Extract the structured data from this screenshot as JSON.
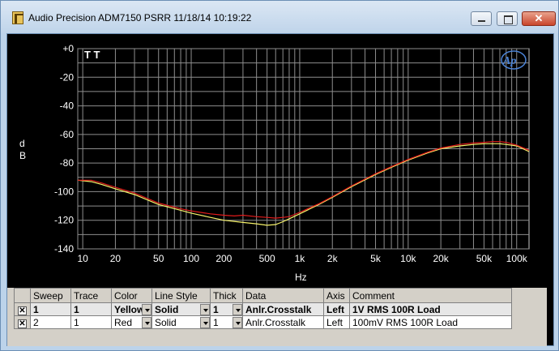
{
  "window": {
    "title": "Audio Precision  ADM7150 PSRR  11/18/14 10:19:22",
    "icon": "app-logo-icon"
  },
  "colors": {
    "yellow": "#f6f26a",
    "red": "#e21b1b",
    "grid": "#8e8e8e",
    "text": "#ffffff"
  },
  "chart_data": {
    "type": "line",
    "xscale": "log",
    "xlabel": "Hz",
    "ylabel": "d\nB",
    "xlim": [
      9,
      130000
    ],
    "ylim": [
      -140,
      0
    ],
    "x_ticks": [
      {
        "v": 10,
        "label": "10"
      },
      {
        "v": 20,
        "label": "20"
      },
      {
        "v": 50,
        "label": "50"
      },
      {
        "v": 100,
        "label": "100"
      },
      {
        "v": 200,
        "label": "200"
      },
      {
        "v": 500,
        "label": "500"
      },
      {
        "v": 1000,
        "label": "1k"
      },
      {
        "v": 2000,
        "label": "2k"
      },
      {
        "v": 5000,
        "label": "5k"
      },
      {
        "v": 10000,
        "label": "10k"
      },
      {
        "v": 20000,
        "label": "20k"
      },
      {
        "v": 50000,
        "label": "50k"
      },
      {
        "v": 100000,
        "label": "100k"
      }
    ],
    "y_ticks": [
      {
        "v": 0,
        "label": "+0"
      },
      {
        "v": -20,
        "label": "-20"
      },
      {
        "v": -40,
        "label": "-40"
      },
      {
        "v": -60,
        "label": "-60"
      },
      {
        "v": -80,
        "label": "-80"
      },
      {
        "v": -100,
        "label": "-100"
      },
      {
        "v": -120,
        "label": "-120"
      },
      {
        "v": -140,
        "label": "-140"
      }
    ],
    "cursor_marks": "T  T",
    "series": [
      {
        "name": "1",
        "color": "#f6f26a",
        "x": [
          9,
          12,
          15,
          20,
          30,
          50,
          80,
          100,
          150,
          200,
          300,
          400,
          500,
          600,
          700,
          800,
          1000,
          1500,
          2000,
          3000,
          5000,
          7000,
          10000,
          15000,
          20000,
          30000,
          40000,
          50000,
          60000,
          70000,
          80000,
          100000,
          130000
        ],
        "y": [
          -92,
          -93,
          -95,
          -98,
          -102,
          -109,
          -113,
          -115,
          -118,
          -120,
          -121.5,
          -122.5,
          -123.5,
          -123,
          -121,
          -119,
          -115.5,
          -109,
          -104,
          -96.5,
          -88,
          -83,
          -78,
          -73,
          -70,
          -68,
          -67,
          -66.5,
          -66.5,
          -66.5,
          -67,
          -68,
          -72
        ]
      },
      {
        "name": "2",
        "color": "#e21b1b",
        "x": [
          9,
          12,
          15,
          20,
          30,
          50,
          80,
          100,
          150,
          200,
          250,
          300,
          400,
          500,
          600,
          700,
          800,
          1000,
          1500,
          2000,
          3000,
          5000,
          7000,
          10000,
          15000,
          20000,
          30000,
          40000,
          50000,
          60000,
          70000,
          80000,
          100000,
          130000
        ],
        "y": [
          -92,
          -92,
          -94,
          -97,
          -101,
          -108,
          -112,
          -113.5,
          -115.5,
          -116.5,
          -117,
          -116.5,
          -117.5,
          -118,
          -118.5,
          -118,
          -117.5,
          -114.5,
          -108.5,
          -103.5,
          -96,
          -87.5,
          -82.5,
          -77.5,
          -72.5,
          -69.5,
          -67,
          -66,
          -65.5,
          -65,
          -65,
          -65.5,
          -67.5,
          -71
        ]
      }
    ]
  },
  "table": {
    "headers": [
      "Sweep",
      "Trace",
      "Color",
      "Line Style",
      "Thick",
      "Data",
      "Axis",
      "Comment"
    ],
    "rows": [
      {
        "checked": "✕",
        "sweep": "1",
        "trace": "1",
        "color": "Yellow",
        "style": "Solid",
        "thick": "1",
        "data": "Anlr.Crosstalk",
        "axis": "Left",
        "comment": "1V RMS 100R Load"
      },
      {
        "checked": "✕",
        "sweep": "2",
        "trace": "1",
        "color": "Red",
        "style": "Solid",
        "thick": "1",
        "data": "Anlr.Crosstalk",
        "axis": "Left",
        "comment": "100mV RMS  100R Load"
      }
    ]
  }
}
